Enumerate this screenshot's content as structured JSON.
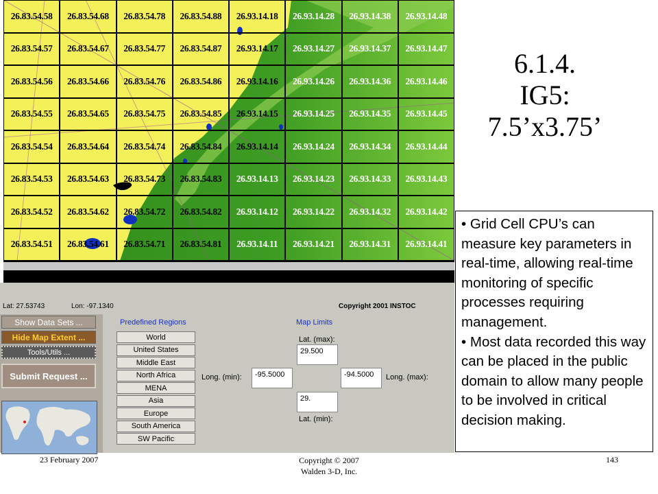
{
  "grid": {
    "rows": [
      [
        "26.83.54.58",
        "26.83.54.68",
        "26.83.54.78",
        "26.83.54.88",
        "26.93.14.18",
        "26.93.14.28",
        "26.93.14.38",
        "26.93.14.48"
      ],
      [
        "26.83.54.57",
        "26.83.54.67",
        "26.83.54.77",
        "26.83.54.87",
        "26.93.14.17",
        "26.93.14.27",
        "26.93.14.37",
        "26.93.14.47"
      ],
      [
        "26.83.54.56",
        "26.83.54.66",
        "26.83.54.76",
        "26.83.54.86",
        "26.93.14.16",
        "26.93.14.26",
        "26.93.14.36",
        "26.93.14.46"
      ],
      [
        "26.83.54.55",
        "26.83.54.65",
        "26.83.54.75",
        "26.83.54.85",
        "26.93.14.15",
        "26.93.14.25",
        "26.93.14.35",
        "26.93.14.45"
      ],
      [
        "26.83.54.54",
        "26.83.54.64",
        "26.83.54.74",
        "26.83.54.84",
        "26.93.14.14",
        "26.93.14.24",
        "26.93.14.34",
        "26.93.14.44"
      ],
      [
        "26.83.54.53",
        "26.83.54.63",
        "26.83.54.73",
        "26.83.54.83",
        "26.93.14.13",
        "26.93.14.23",
        "26.93.14.33",
        "26.93.14.43"
      ],
      [
        "26.83.54.52",
        "26.83.54.62",
        "26.83.54.72",
        "26.83.54.82",
        "26.93.14.12",
        "26.93.14.22",
        "26.93.14.32",
        "26.93.14.42"
      ],
      [
        "26.83.54.51",
        "26.83.54.61",
        "26.83.54.71",
        "26.83.54.81",
        "26.93.14.11",
        "26.93.14.21",
        "26.93.14.31",
        "26.93.14.41"
      ]
    ]
  },
  "app": {
    "lat": "Lat: 27.53743",
    "lon": "Lon: -97.1340",
    "copyright": "Copyright 2001  INSTOC",
    "buttons": {
      "show_data": "Show Data Sets ...",
      "hide_map": "Hide Map Extent ...",
      "tools": "Tools/Utils ...",
      "submit": "Submit Request ..."
    },
    "predefined_label": "Predefined Regions",
    "regions": [
      "World",
      "United States",
      "Middle East",
      "North Africa",
      "MENA",
      "Asia",
      "Europe",
      "South America",
      "SW Pacific"
    ],
    "map_limits_label": "Map Limits",
    "lat_max_label": "Lat. (max):",
    "lat_min_label": "Lat. (min):",
    "long_min_label": "Long. (min):",
    "long_max_label": "Long. (max):",
    "lat_max": "29.500",
    "lat_min": "29.",
    "long_min": "-95.5000",
    "long_max": "-94.5000"
  },
  "slide": {
    "title_line1": "6.1.4.",
    "title_line2": "IG5:",
    "title_line3": "7.5’x3.75’",
    "bullet1": "• Grid Cell CPU’s can measure key parameters in real-time, allowing real-time monitoring of specific processes requiring management.",
    "bullet2": "• Most data recorded this way can be placed in the public domain to allow many people to be involved in critical decision making."
  },
  "footer": {
    "date": "23 February 2007",
    "copyright_line1": "Copyright © 2007",
    "copyright_line2": "Walden 3-D, Inc.",
    "page": "143"
  },
  "colors": {
    "land": "#f4f05a",
    "water": "#3fa020",
    "water_light": "#7cc83c",
    "lake": "#1030c0"
  }
}
